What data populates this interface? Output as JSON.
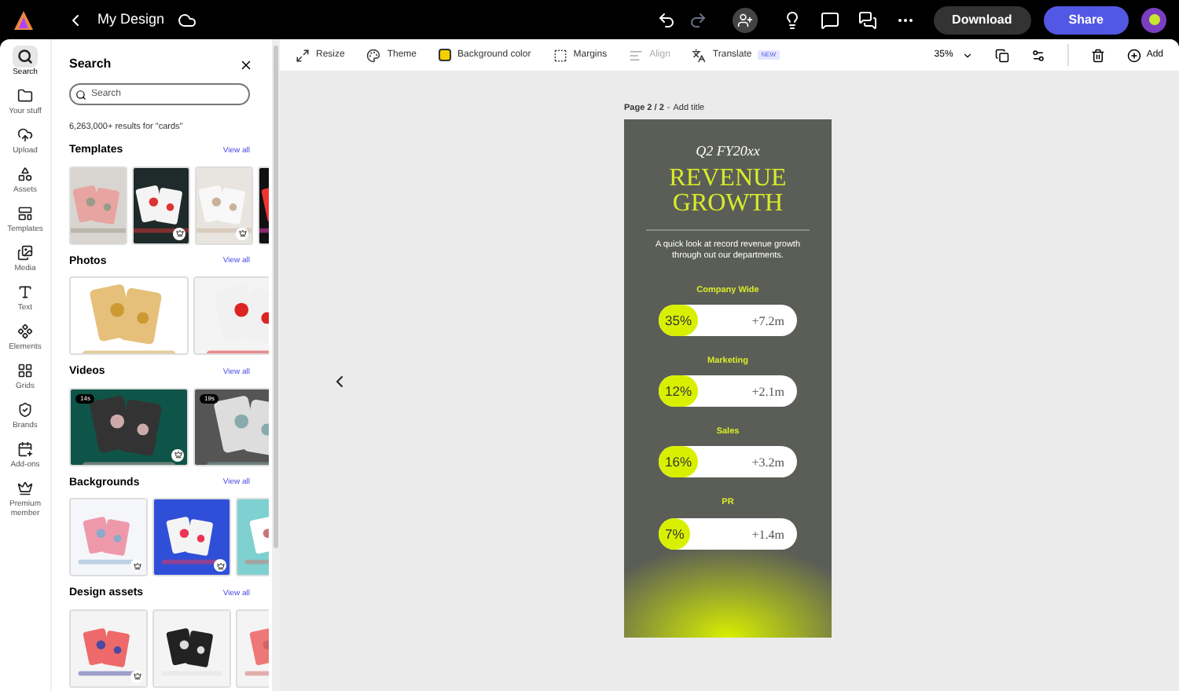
{
  "topbar": {
    "title": "My Design",
    "download": "Download",
    "share": "Share"
  },
  "rail": [
    {
      "label": "Search",
      "selected": true
    },
    {
      "label": "Your stuff",
      "selected": false
    },
    {
      "label": "Upload",
      "selected": false
    },
    {
      "label": "Assets",
      "selected": false
    },
    {
      "label": "Templates",
      "selected": false
    },
    {
      "label": "Media",
      "selected": false
    },
    {
      "label": "Text",
      "selected": false
    },
    {
      "label": "Elements",
      "selected": false
    },
    {
      "label": "Grids",
      "selected": false
    },
    {
      "label": "Brands",
      "selected": false
    },
    {
      "label": "Add-ons",
      "selected": false
    },
    {
      "label": "Premium member",
      "selected": false
    }
  ],
  "panel": {
    "title": "Search",
    "search_placeholder": "Search",
    "results": "6,263,000+ results for \"cards\"",
    "sections": [
      {
        "title": "Templates",
        "link": "View all",
        "items": [
          {
            "kind": "picture",
            "premium": false
          },
          {
            "kind": "picture",
            "premium": true
          },
          {
            "kind": "picture",
            "premium": true
          },
          {
            "kind": "picture"
          }
        ]
      },
      {
        "title": "Photos",
        "link": "View all",
        "items": [
          {
            "kind": "picture",
            "premium": false
          },
          {
            "kind": "picture"
          }
        ]
      },
      {
        "title": "Videos",
        "link": "View all",
        "items": [
          {
            "kind": "picture",
            "premium": true,
            "duration": "14s"
          },
          {
            "kind": "picture",
            "duration": "19s"
          }
        ]
      },
      {
        "title": "Backgrounds",
        "link": "View all",
        "items": [
          {
            "kind": "picture",
            "premium": true
          },
          {
            "kind": "picture",
            "premium": true
          },
          {
            "kind": "picture"
          }
        ]
      },
      {
        "title": "Design assets",
        "link": "View all",
        "items": [
          {
            "kind": "picture",
            "premium": true
          },
          {
            "kind": "picture",
            "premium": false
          },
          {
            "kind": "picture"
          }
        ]
      }
    ]
  },
  "toolbar": [
    {
      "label": "Resize",
      "kind": "resize",
      "disabled": false
    },
    {
      "label": "Theme",
      "kind": "theme",
      "disabled": false
    },
    {
      "label": "Background color",
      "kind": "color",
      "disabled": false,
      "color": "#f5d000"
    },
    {
      "label": "Margins",
      "kind": "margins",
      "disabled": false
    },
    {
      "label": "Align",
      "kind": "align",
      "disabled": true
    },
    {
      "label": "Translate",
      "kind": "translate",
      "disabled": false,
      "badge": "NEW"
    }
  ],
  "zoom": "35%",
  "add": "Add",
  "page": {
    "label": "Page 2 / 2",
    "separator": "-",
    "title_hint": "Add title",
    "kicker": "Q2 FY20xx",
    "headline": "REVENUE GROWTH",
    "description": "A quick look at record revenue growth through out our departments.",
    "stats": [
      {
        "label": "Company Wide",
        "percent": "35%",
        "amount": "+7.2m"
      },
      {
        "label": "Marketing",
        "percent": "12%",
        "amount": "+2.1m"
      },
      {
        "label": "Sales",
        "percent": "16%",
        "amount": "+3.2m"
      },
      {
        "label": "PR",
        "percent": "7%",
        "amount": "+1.4m"
      }
    ]
  }
}
